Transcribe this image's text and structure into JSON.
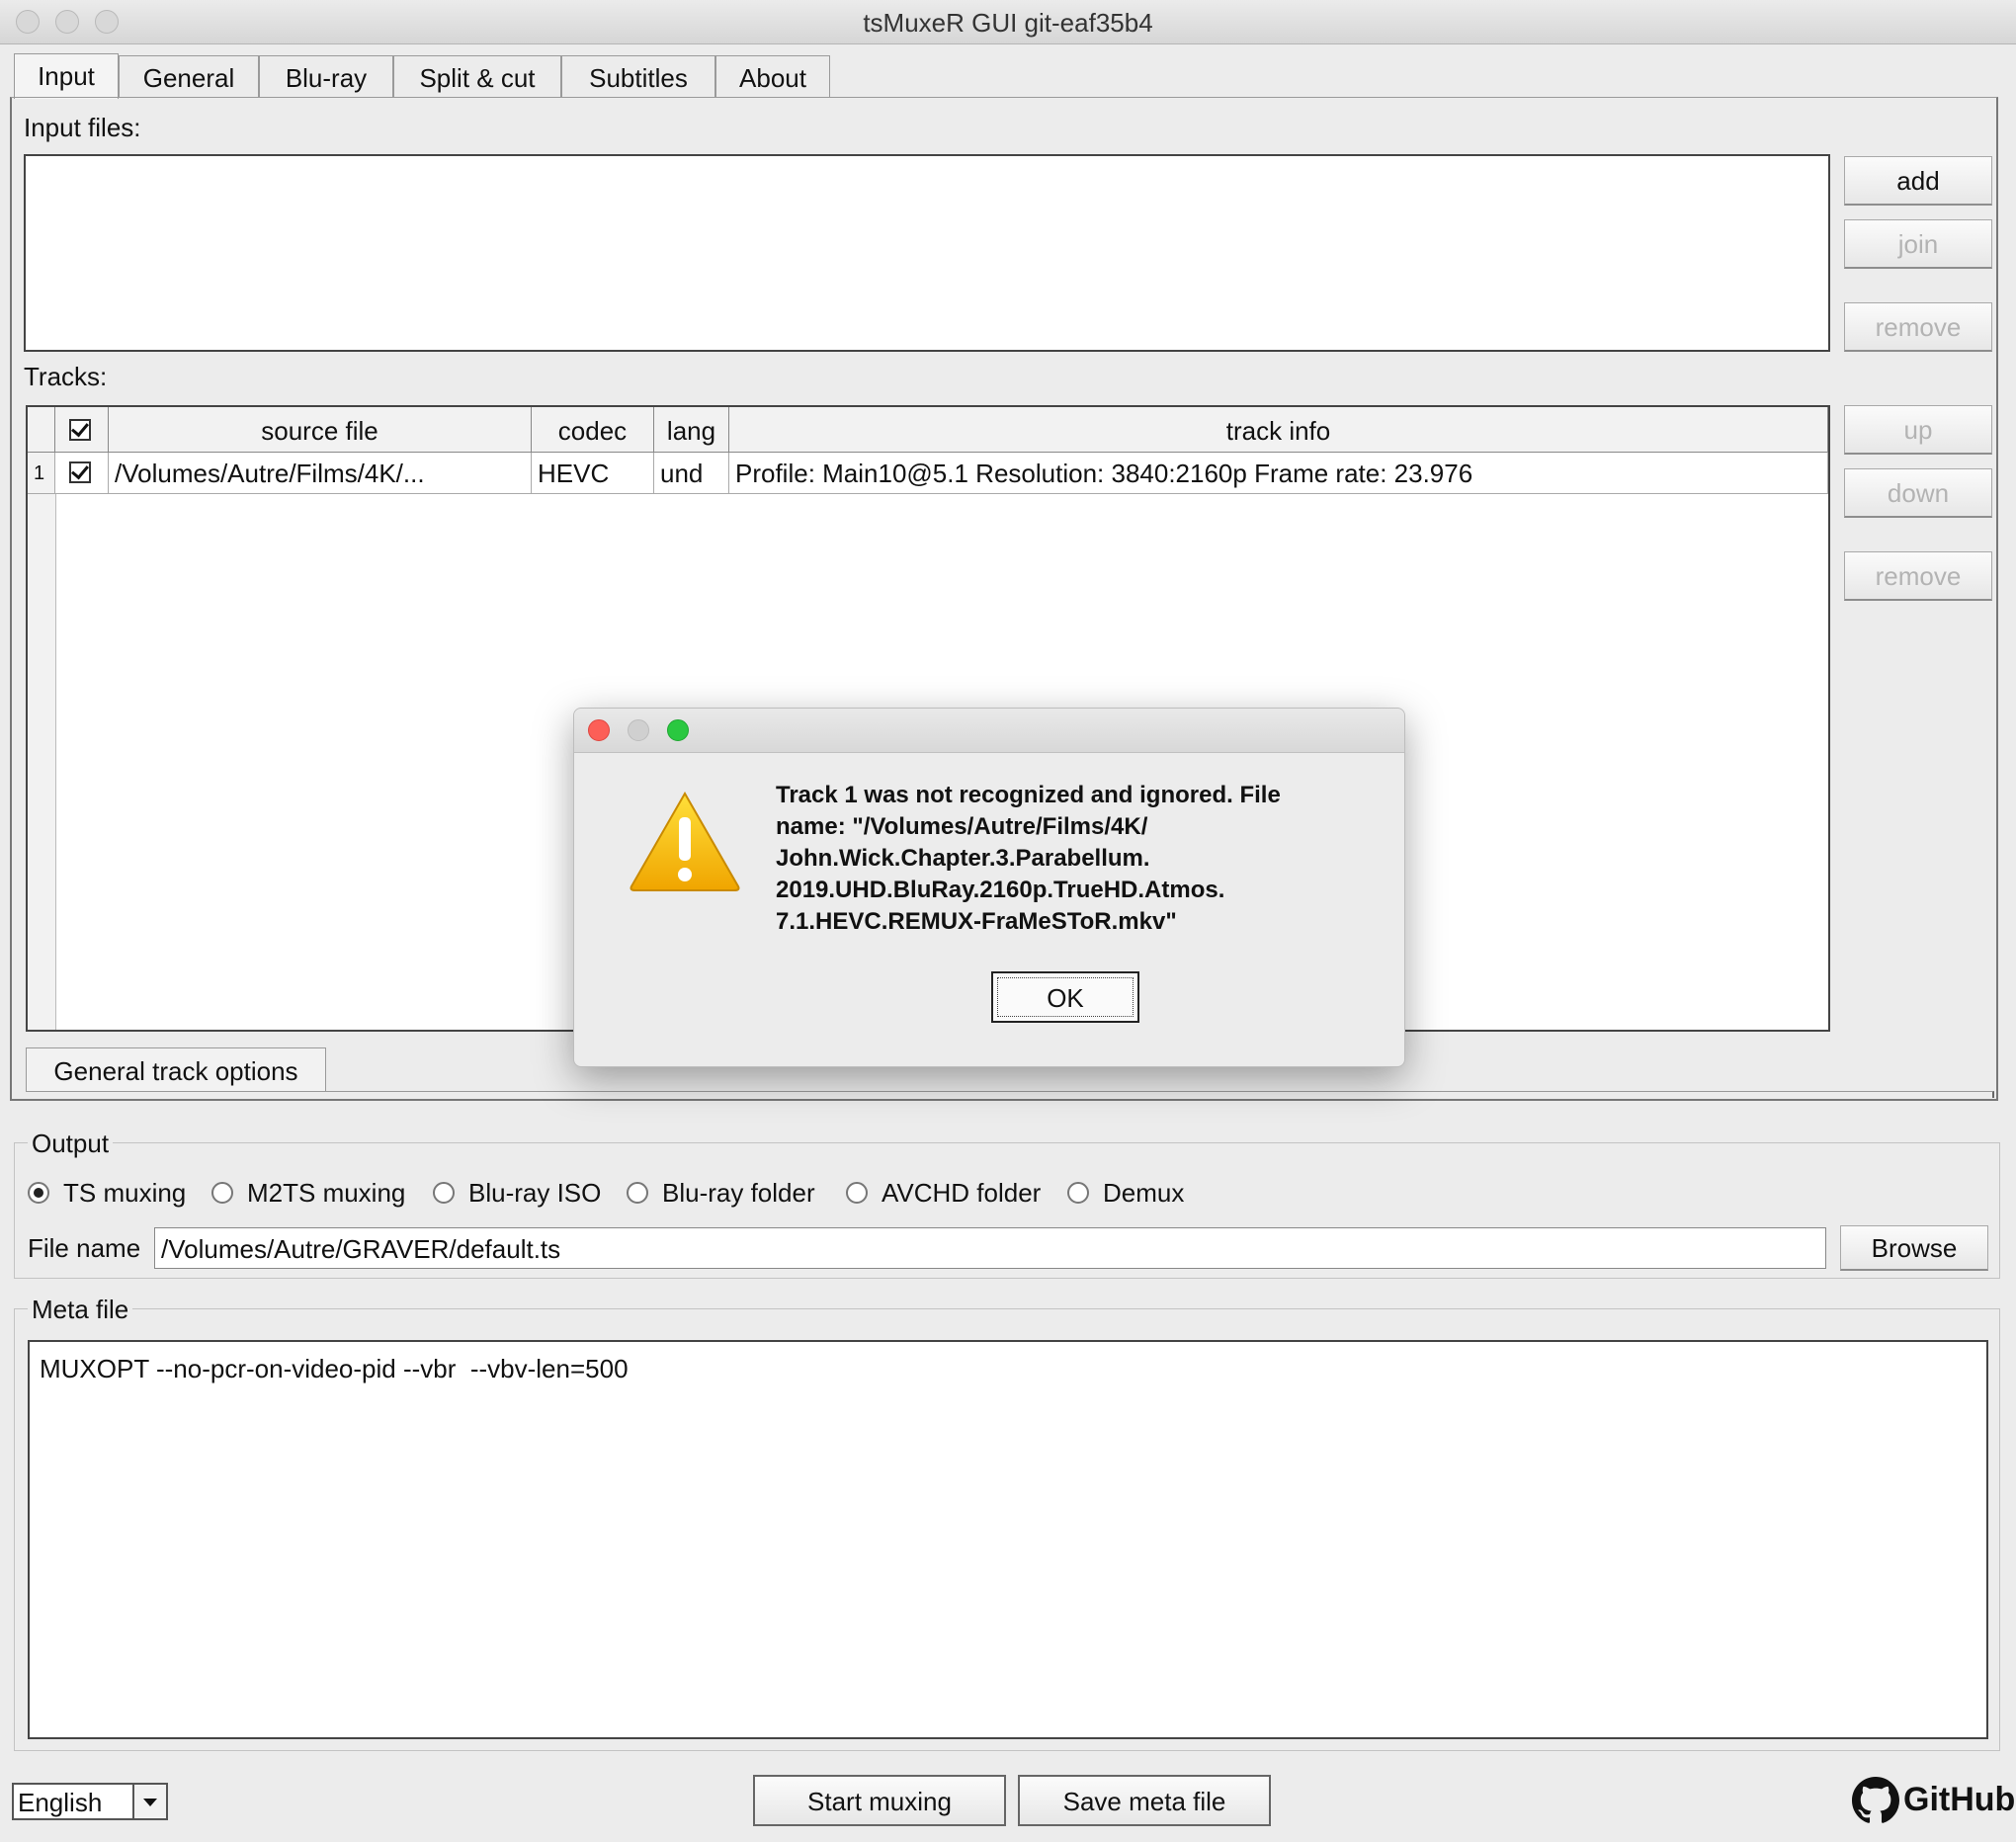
{
  "window": {
    "title": "tsMuxeR GUI git-eaf35b4"
  },
  "tabs": [
    "Input",
    "General",
    "Blu-ray",
    "Split & cut",
    "Subtitles",
    "About"
  ],
  "input": {
    "input_files_label": "Input files:",
    "buttons": {
      "add": "add",
      "join": "join",
      "remove": "remove"
    },
    "tracks_label": "Tracks:",
    "track_buttons": {
      "up": "up",
      "down": "down",
      "remove": "remove"
    },
    "table": {
      "columns": [
        "source file",
        "codec",
        "lang",
        "track info"
      ],
      "rows": [
        {
          "index": "1",
          "checked": true,
          "source_file": "/Volumes/Autre/Films/4K/...",
          "codec": "HEVC",
          "lang": "und",
          "track_info": "Profile: Main10@5.1 Resolution: 3840:2160p  Frame rate: 23.976"
        }
      ]
    },
    "general_track_options_tab": "General track options"
  },
  "output": {
    "legend": "Output",
    "modes": [
      "TS muxing",
      "M2TS muxing",
      "Blu-ray ISO",
      "Blu-ray folder",
      "AVCHD folder",
      "Demux"
    ],
    "selected_mode": "TS muxing",
    "file_name_label": "File name",
    "file_name_value": "/Volumes/Autre/GRAVER/default.ts",
    "browse": "Browse"
  },
  "meta": {
    "legend": "Meta file",
    "content": "MUXOPT --no-pcr-on-video-pid --vbr  --vbv-len=500"
  },
  "footer": {
    "language": "English",
    "start_muxing": "Start muxing",
    "save_meta": "Save meta file",
    "github": "GitHub"
  },
  "dialog": {
    "icon": "warning-icon",
    "message_lines": [
      "Track 1 was not recognized and ignored. File",
      "name: \"/Volumes/Autre/Films/4K/",
      "John.Wick.Chapter.3.Parabellum.",
      "2019.UHD.BluRay.2160p.TrueHD.Atmos.",
      "7.1.HEVC.REMUX-FraMeSToR.mkv\""
    ],
    "ok": "OK"
  },
  "colors": {
    "close": "#fc5f57",
    "minimize_disabled": "#d0d0d0",
    "zoom": "#2ac840",
    "warning": "#f5b800"
  }
}
